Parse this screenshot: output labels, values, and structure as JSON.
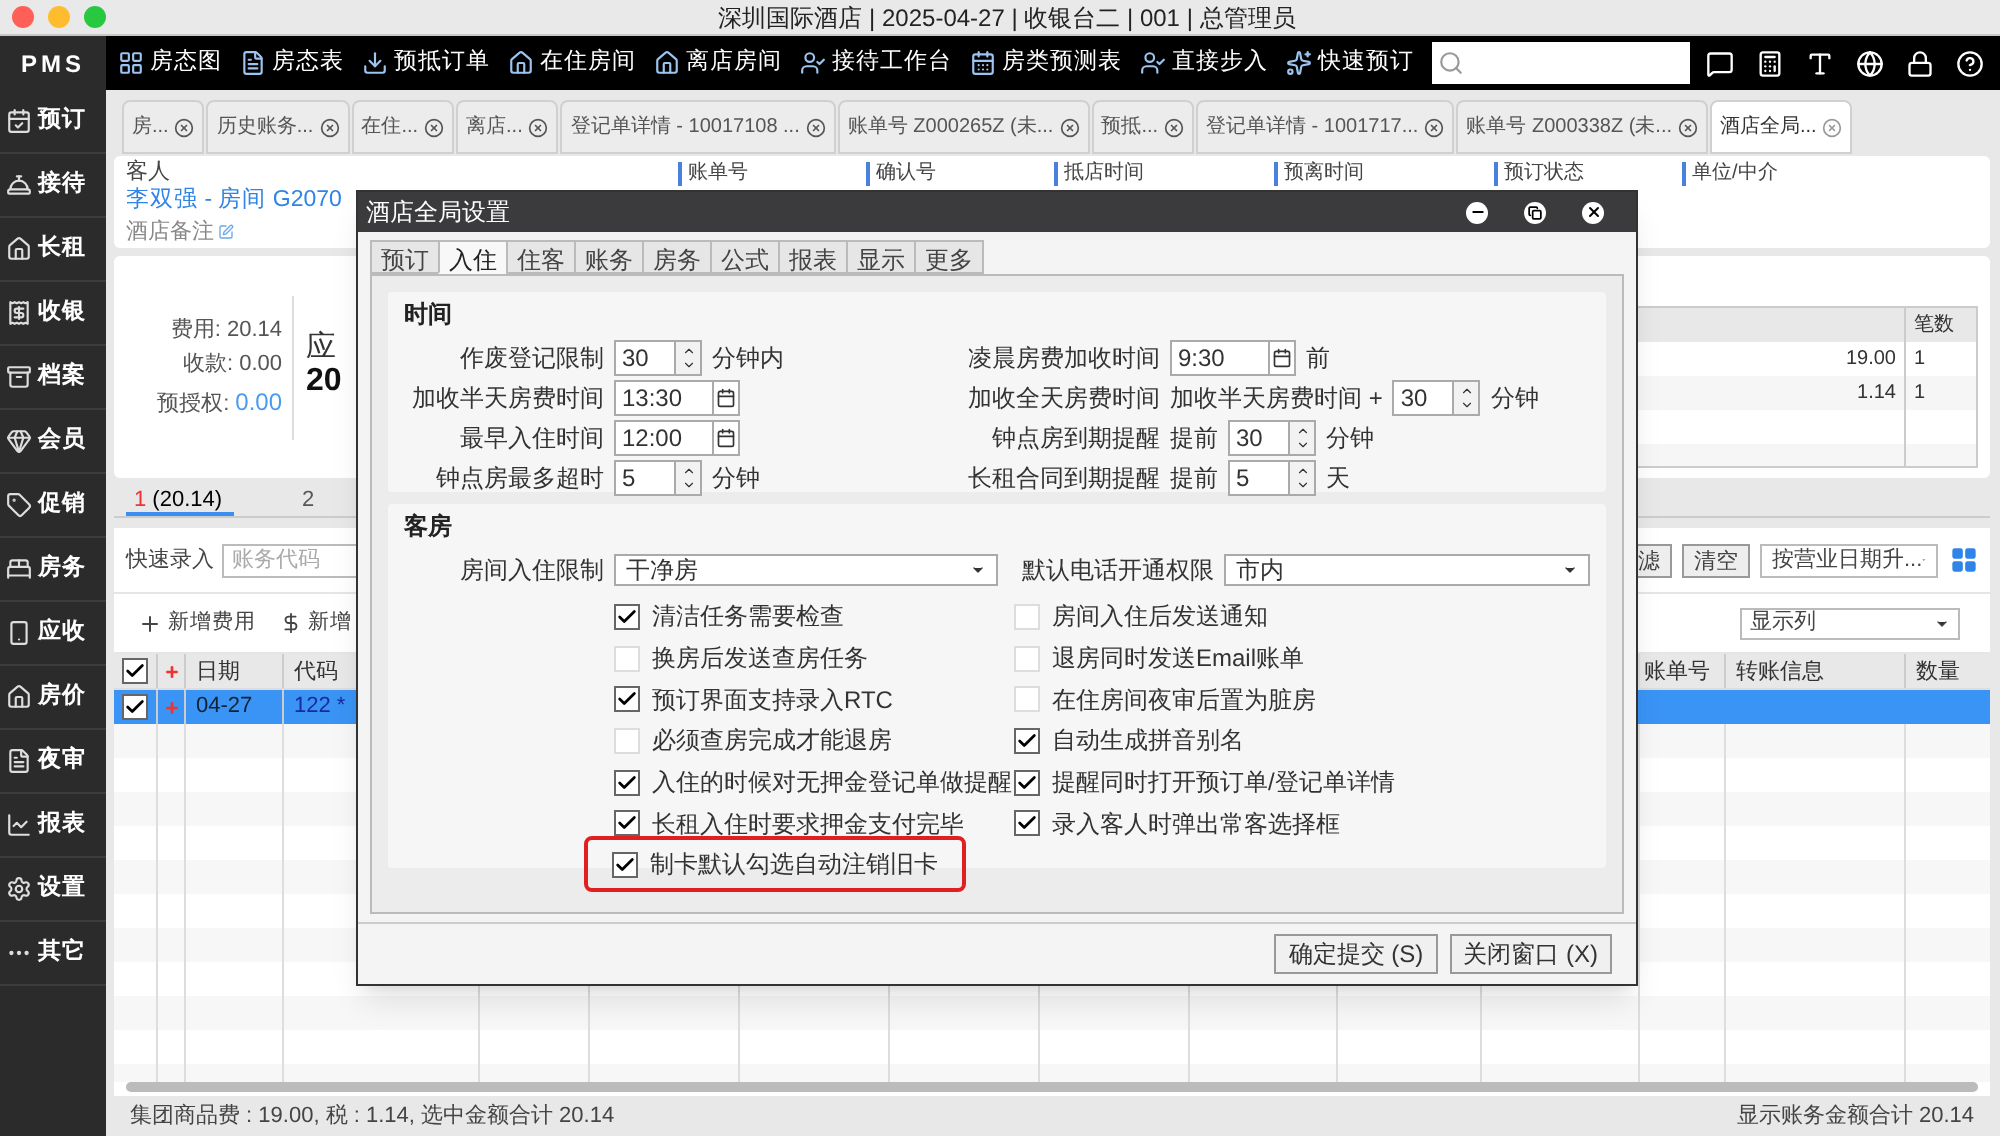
{
  "window": {
    "title": "深圳国际酒店 | 2025-04-27 | 收银台二 | 001 | 总管理员"
  },
  "toolbar": {
    "logo": "PMS",
    "items": [
      "房态图",
      "房态表",
      "预抵订单",
      "在住房间",
      "离店房间",
      "接待工作台",
      "房类预测表",
      "直接步入",
      "快速预订"
    ]
  },
  "sidebar": {
    "items": [
      "预订",
      "接待",
      "长租",
      "收银",
      "档案",
      "会员",
      "促销",
      "房务",
      "应收",
      "房价",
      "夜审",
      "报表",
      "设置",
      "其它"
    ]
  },
  "tabs": [
    {
      "label": "房...",
      "selected": false
    },
    {
      "label": "历史账务...",
      "selected": false
    },
    {
      "label": "在住...",
      "selected": false
    },
    {
      "label": "离店...",
      "selected": false
    },
    {
      "label": "登记单详情 - 10017108 ...",
      "selected": false
    },
    {
      "label": "账单号 Z000265Z (未...",
      "selected": false
    },
    {
      "label": "预抵...",
      "selected": false
    },
    {
      "label": "登记单详情 - 1001717...",
      "selected": false
    },
    {
      "label": "账单号 Z000338Z (未...",
      "selected": false
    },
    {
      "label": "酒店全局...",
      "selected": true
    }
  ],
  "guest": {
    "label": "客人",
    "name": "李双强 - 房间 G2070",
    "note": "酒店备注",
    "columns": [
      "账单号",
      "确认号",
      "抵店时间",
      "预离时间",
      "预订状态",
      "单位/中介"
    ]
  },
  "summary": {
    "lines": [
      {
        "label": "费用:",
        "value": "20.14",
        "kind": "plain"
      },
      {
        "label": "收款:",
        "value": "0.00",
        "kind": "plain"
      },
      {
        "label": "预授权:",
        "value": "0.00",
        "kind": "link"
      }
    ],
    "big_label": "应",
    "big_value": "20",
    "table": {
      "header": "笔数",
      "rows": [
        {
          "amount": "19.00",
          "count": "1"
        },
        {
          "amount": "1.14",
          "count": "1"
        }
      ]
    }
  },
  "account_tabs": [
    {
      "number": "1",
      "amount": "(20.14)",
      "selected": true
    },
    {
      "number": "2",
      "selected": false
    }
  ],
  "filter": {
    "label": "快速录入",
    "placeholder": "账务代码",
    "buttons": [
      "滤",
      "清空"
    ],
    "sort": "按营业日期升..."
  },
  "actions": {
    "buttons": [
      "新增费用",
      "新增"
    ],
    "columns_select": "显示列"
  },
  "table": {
    "header_checked": true,
    "columns": [
      "日期",
      "代码",
      "账单号",
      "转账信息",
      "数量"
    ],
    "rows": [
      {
        "checked": true,
        "selected": true,
        "date": "04-27",
        "code": "122 *"
      }
    ]
  },
  "status_bar": {
    "left": "集团商品费 : 19.00, 税 : 1.14, 选中金额合计 20.14",
    "right": "显示账务金额合计 20.14"
  },
  "dialog": {
    "title": "酒店全局设置",
    "tabs": [
      {
        "label": "预订",
        "selected": false
      },
      {
        "label": "入住",
        "selected": true
      },
      {
        "label": "住客",
        "selected": false
      },
      {
        "label": "账务",
        "selected": false
      },
      {
        "label": "房务",
        "selected": false
      },
      {
        "label": "公式",
        "selected": false
      },
      {
        "label": "报表",
        "selected": false
      },
      {
        "label": "显示",
        "selected": false
      },
      {
        "label": "更多",
        "selected": false
      }
    ],
    "time": {
      "title": "时间",
      "left": [
        {
          "label": "作废登记限制",
          "kind": "spin",
          "value": "30",
          "unit": "分钟内"
        },
        {
          "label": "加收半天房费时间",
          "kind": "time",
          "value": "13:30"
        },
        {
          "label": "最早入住时间",
          "kind": "time",
          "value": "12:00"
        },
        {
          "label": "钟点房最多超时",
          "kind": "spin",
          "value": "5",
          "unit": "分钟"
        }
      ],
      "right": [
        {
          "label": "凌晨房费加收时间",
          "kind": "time",
          "value": "9:30",
          "unit": "前"
        },
        {
          "label": "加收全天房费时间",
          "prefix": "加收半天房费时间 +",
          "kind": "spin",
          "value": "30",
          "unit": "分钟"
        },
        {
          "label": "钟点房到期提醒",
          "prefix": "提前",
          "kind": "spin",
          "value": "30",
          "unit": "分钟"
        },
        {
          "label": "长租合同到期提醒",
          "prefix": "提前",
          "kind": "spin",
          "value": "5",
          "unit": "天"
        }
      ]
    },
    "rooms": {
      "title": "客房",
      "selects": [
        {
          "label": "房间入住限制",
          "value": "干净房"
        },
        {
          "label": "默认电话开通权限",
          "value": "市内"
        }
      ],
      "left": [
        {
          "label": "清洁任务需要检查",
          "checked": true,
          "highlighted": false
        },
        {
          "label": "换房后发送查房任务",
          "checked": false,
          "highlighted": false
        },
        {
          "label": "预订界面支持录入RTC",
          "checked": true,
          "highlighted": false
        },
        {
          "label": "必须查房完成才能退房",
          "checked": false,
          "highlighted": false
        },
        {
          "label": "入住的时候对无押金登记单做提醒",
          "checked": true,
          "highlighted": false
        },
        {
          "label": "长租入住时要求押金支付完毕",
          "checked": true,
          "highlighted": false
        },
        {
          "label": "制卡默认勾选自动注销旧卡",
          "checked": true,
          "highlighted": true
        }
      ],
      "right": [
        {
          "label": "房间入住后发送通知",
          "checked": false,
          "highlighted": false
        },
        {
          "label": "退房同时发送Email账单",
          "checked": false,
          "highlighted": false
        },
        {
          "label": "在住房间夜审后置为脏房",
          "checked": false,
          "highlighted": false
        },
        {
          "label": "自动生成拼音别名",
          "checked": true,
          "highlighted": false
        },
        {
          "label": "提醒同时打开预订单/登记单详情",
          "checked": true,
          "highlighted": false
        },
        {
          "label": "录入客人时弹出常客选择框",
          "checked": true,
          "highlighted": false
        }
      ]
    },
    "buttons": [
      "确定提交 (S)",
      "关闭窗口 (X)"
    ]
  }
}
